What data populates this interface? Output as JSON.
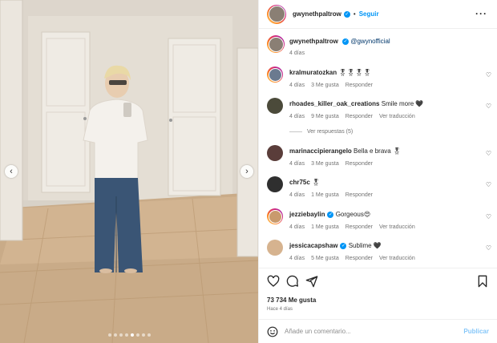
{
  "post": {
    "carousel": {
      "slides": 8,
      "active_slide": 5
    },
    "header": {
      "username": "gwynethpaltrow",
      "verified": true,
      "follow_label": "Seguir",
      "more_icon": "more-horizontal-icon"
    },
    "caption": {
      "username": "gwynethpaltrow",
      "mention": "@gwynofficial",
      "time": "4 días"
    },
    "comments": [
      {
        "username": "kralmuratozkan",
        "text": "🎖🎖🎖🎖",
        "time": "4 días",
        "likes": "3 Me gusta",
        "reply": "Responder",
        "translate": ""
      },
      {
        "username": "rhoades_killer_oak_creations",
        "text": "Smile more 🖤",
        "time": "4 días",
        "likes": "9 Me gusta",
        "reply": "Responder",
        "translate": "Ver traducción"
      },
      {
        "username": "marinaccipierangelo",
        "text": "Bella e brava 🎖",
        "time": "4 días",
        "likes": "3 Me gusta",
        "reply": "Responder",
        "translate": ""
      },
      {
        "username": "chr75c",
        "text": "🎖",
        "time": "4 días",
        "likes": "1 Me gusta",
        "reply": "Responder",
        "translate": ""
      },
      {
        "username": "jezziebaylin",
        "text": "Gorgeous😍",
        "time": "4 días",
        "likes": "1 Me gusta",
        "reply": "Responder",
        "translate": "Ver traducción",
        "verified": true
      },
      {
        "username": "jessicacapshaw",
        "text": "Sublime 🖤",
        "time": "4 días",
        "likes": "5 Me gusta",
        "reply": "Responder",
        "translate": "Ver traducción",
        "verified": true
      }
    ],
    "view_replies": "Ver respuestas (5)",
    "likes_count": "73 734 Me gusta",
    "posted_ago": "Hace 4 días",
    "add_comment": {
      "placeholder": "Añade un comentario...",
      "publish_label": "Publicar"
    },
    "colors": {
      "accent": "#0095f6",
      "text": "#262626",
      "muted": "#737373"
    }
  }
}
